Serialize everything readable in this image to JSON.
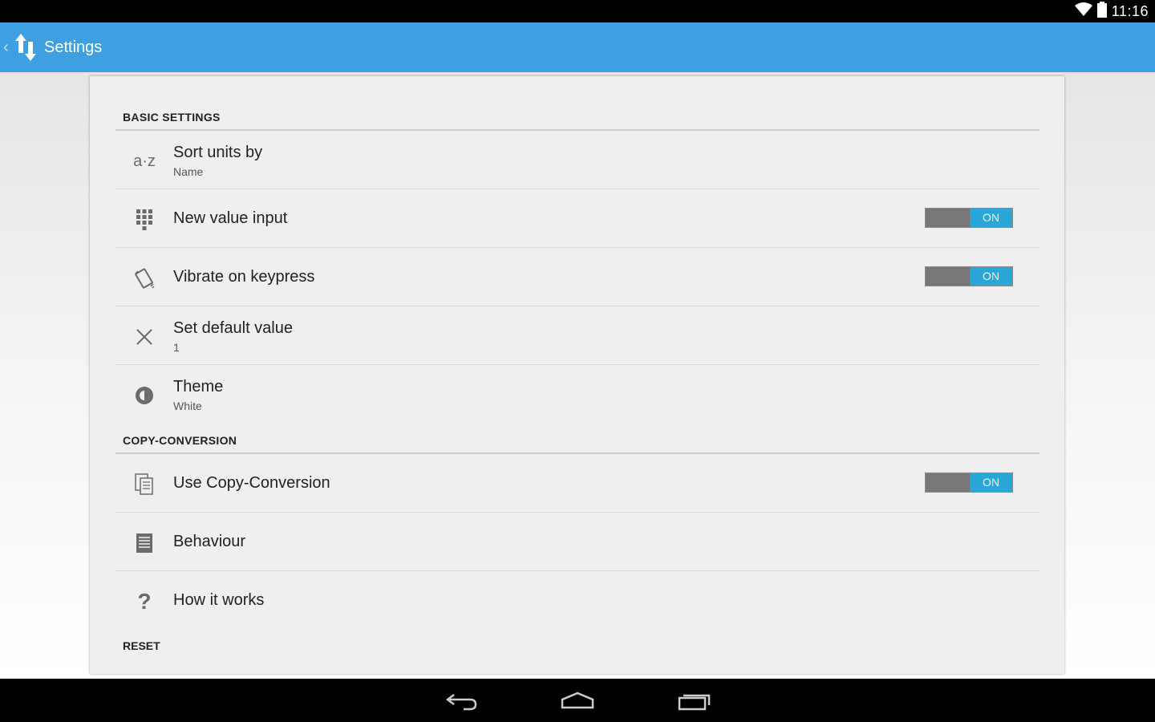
{
  "status_bar": {
    "time": "11:16",
    "icons": [
      "wifi-icon",
      "battery-icon"
    ]
  },
  "action_bar": {
    "title": "Settings",
    "color": "#3e9fe1",
    "icons": [
      "up-caret-icon",
      "app-convert-icon"
    ]
  },
  "sections": [
    {
      "header": "BASIC SETTINGS",
      "items": [
        {
          "icon": "az-sort-icon",
          "title": "Sort units by",
          "summary": "Name"
        },
        {
          "icon": "keypad-icon",
          "title": "New value input",
          "toggle": "ON"
        },
        {
          "icon": "vibrate-icon",
          "title": "Vibrate on keypress",
          "toggle": "ON"
        },
        {
          "icon": "close-x-icon",
          "title": "Set default value",
          "summary": "1"
        },
        {
          "icon": "brightness-icon",
          "title": "Theme",
          "summary": "White"
        }
      ]
    },
    {
      "header": "COPY-CONVERSION",
      "items": [
        {
          "icon": "copy-icon",
          "title": "Use Copy-Conversion",
          "toggle": "ON"
        },
        {
          "icon": "list-icon",
          "title": "Behaviour"
        },
        {
          "icon": "question-icon",
          "title": "How it works"
        }
      ]
    }
  ],
  "reset_label": "RESET",
  "toggle_color": "#2aa7d8",
  "nav_bar": {
    "icons": [
      "back-icon",
      "home-icon",
      "recents-icon"
    ]
  }
}
